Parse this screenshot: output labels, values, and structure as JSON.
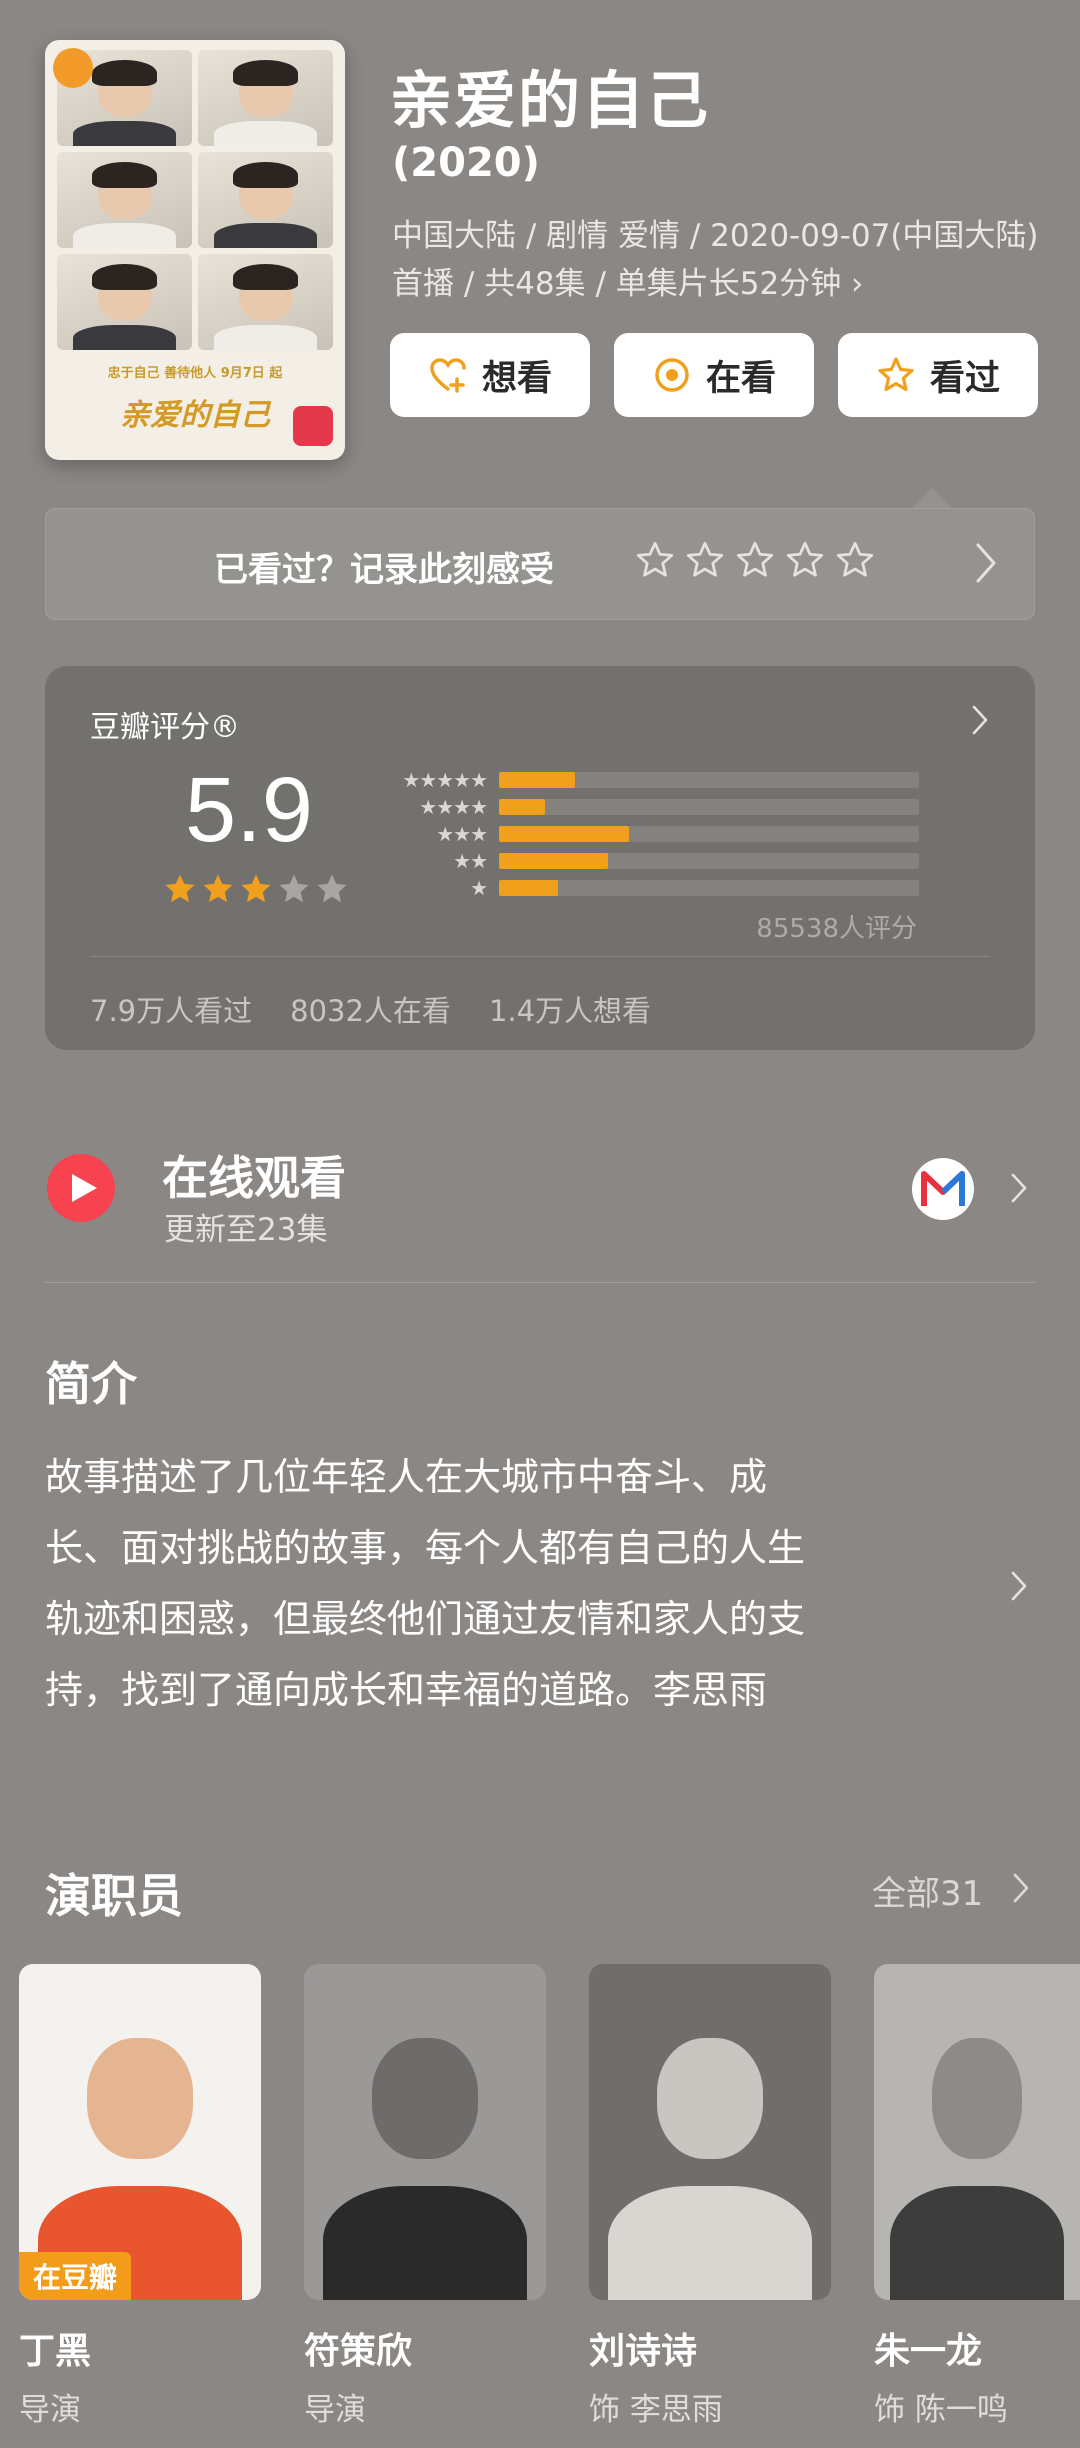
{
  "header": {
    "title": "亲爱的自己",
    "year": "(2020)",
    "meta": "中国大陆 / 剧情 爱情 / 2020-09-07(中国大陆)首播 / 共48集 / 单集片长52分钟 ›",
    "poster": {
      "tagline": "忠于自己 善待他人  9月7日 起",
      "title_art": "亲爱的自己"
    },
    "actions": [
      {
        "label": "想看",
        "icon": "heart-plus-icon"
      },
      {
        "label": "在看",
        "icon": "target-circle-icon"
      },
      {
        "label": "看过",
        "icon": "star-outline-icon"
      }
    ],
    "accent_color": "#f0a01c"
  },
  "record": {
    "prompt": "已看过？记录此刻感受",
    "star_count": 5
  },
  "rating": {
    "label": "豆瓣评分®",
    "score": "5.9",
    "stars_filled": 3,
    "stars_total": 5,
    "distribution": [
      {
        "stars": 5,
        "value": 0.18
      },
      {
        "stars": 4,
        "value": 0.11
      },
      {
        "stars": 3,
        "value": 0.31
      },
      {
        "stars": 2,
        "value": 0.26
      },
      {
        "stars": 1,
        "value": 0.14
      }
    ],
    "count_text": "85538人评分",
    "stats": [
      "7.9万人看过",
      "8032人在看",
      "1.4万人想看"
    ]
  },
  "online": {
    "title": "在线观看",
    "subtitle": "更新至23集",
    "provider_icon": "mgtv-logo-icon",
    "play_color": "#f6434f"
  },
  "synopsis": {
    "title": "简介",
    "lines": [
      "故事描述了几位年轻人在大城市中奋斗、成",
      "长、面对挑战的故事，每个人都有自己的人生",
      "轨迹和困惑，但最终他们通过友情和家人的支",
      "持，找到了通向成长和幸福的道路。李思雨"
    ]
  },
  "cast": {
    "title": "演职员",
    "all_label": "全部31",
    "members": [
      {
        "name": "丁黑",
        "role": "导演",
        "badge": "在豆瓣"
      },
      {
        "name": "符策欣",
        "role": "导演",
        "badge": ""
      },
      {
        "name": "刘诗诗",
        "role": "饰 李思雨",
        "badge": ""
      },
      {
        "name": "朱一龙",
        "role": "饰 陈一鸣",
        "badge": ""
      }
    ]
  }
}
